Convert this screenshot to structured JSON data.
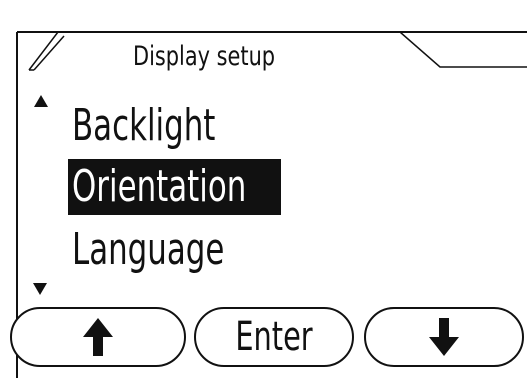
{
  "screen": {
    "title": "Display setup"
  },
  "menu": {
    "items": [
      {
        "label": "Backlight"
      },
      {
        "label": "Orientation",
        "selected": true
      },
      {
        "label": "Language"
      }
    ],
    "scroll_up_icon": "triangle-up-icon",
    "scroll_down_icon": "triangle-down-icon"
  },
  "softkeys": {
    "up": {
      "icon": "arrow-up-icon"
    },
    "enter": {
      "label": "Enter"
    },
    "down": {
      "icon": "arrow-down-icon"
    }
  },
  "colors": {
    "foreground": "#111111",
    "background": "#ffffff",
    "selection": "#111111"
  }
}
